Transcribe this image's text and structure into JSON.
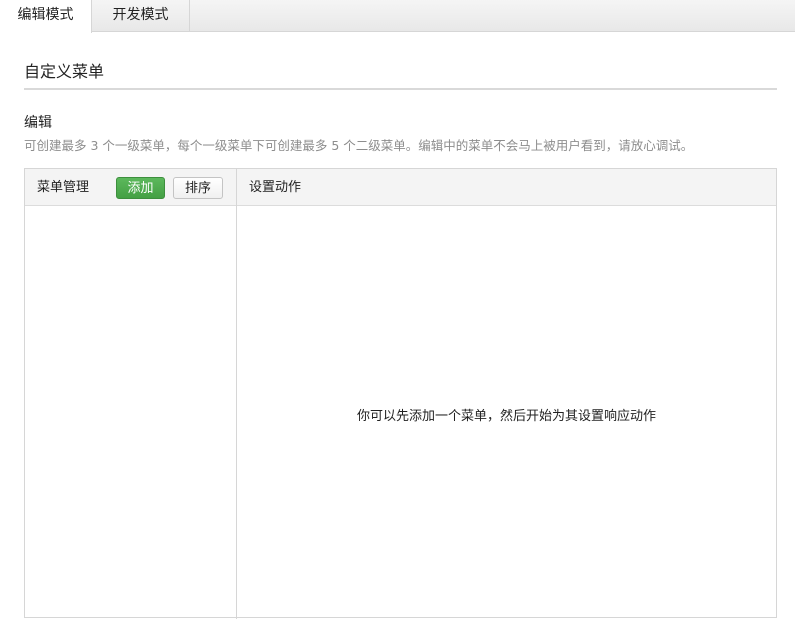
{
  "tabs": [
    {
      "label": "编辑模式",
      "active": true
    },
    {
      "label": "开发模式",
      "active": false
    }
  ],
  "section": {
    "title": "自定义菜单"
  },
  "edit": {
    "title": "编辑",
    "description": "可创建最多 3 个一级菜单，每个一级菜单下可创建最多 5 个二级菜单。编辑中的菜单不会马上被用户看到，请放心调试。"
  },
  "menu_panel": {
    "label": "菜单管理",
    "add_label": "添加",
    "sort_label": "排序"
  },
  "action_panel": {
    "label": "设置动作",
    "empty_hint": "你可以先添加一个菜单，然后开始为其设置响应动作"
  },
  "colors": {
    "add_button": "#4cae4c",
    "description_text": "#8d8d8d"
  }
}
